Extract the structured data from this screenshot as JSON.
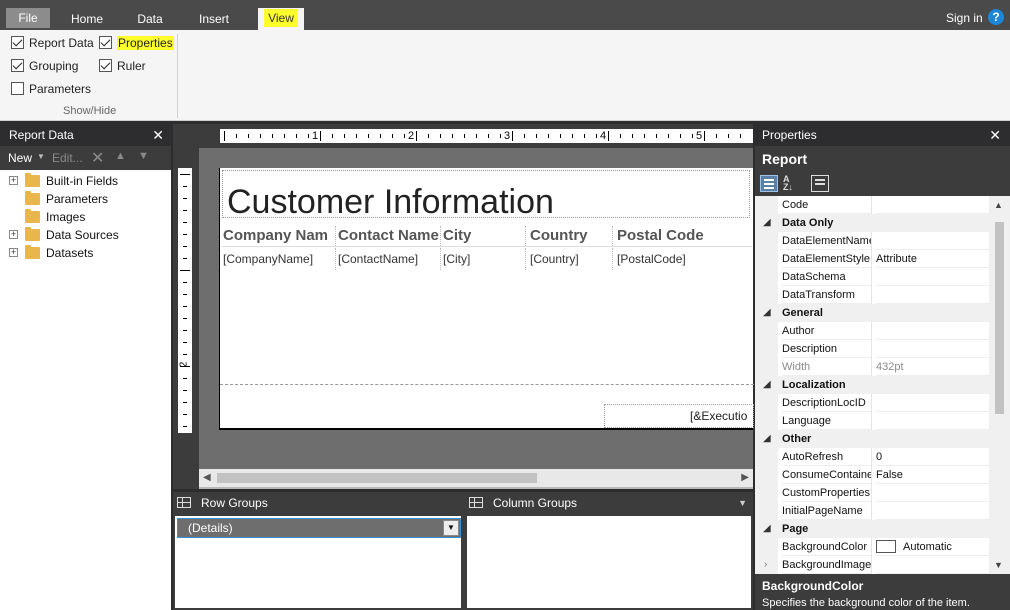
{
  "ribbon": {
    "tabs": [
      "File",
      "Home",
      "Data",
      "Insert",
      "View"
    ],
    "active_tab": "View",
    "sign_in": "Sign in",
    "help": "?",
    "checkboxes": {
      "report_data": {
        "label": "Report Data",
        "checked": true
      },
      "grouping": {
        "label": "Grouping",
        "checked": true
      },
      "parameters": {
        "label": "Parameters",
        "checked": false
      },
      "properties": {
        "label": "Properties",
        "checked": true
      },
      "ruler": {
        "label": "Ruler",
        "checked": true
      }
    },
    "group_label": "Show/Hide"
  },
  "report_data_panel": {
    "title": "Report Data",
    "close": "✕",
    "toolbar": {
      "new": "New",
      "edit": "Edit..."
    },
    "tree": [
      {
        "label": "Built-in Fields",
        "expandable": true
      },
      {
        "label": "Parameters",
        "expandable": false
      },
      {
        "label": "Images",
        "expandable": false
      },
      {
        "label": "Data Sources",
        "expandable": true
      },
      {
        "label": "Datasets",
        "expandable": true
      }
    ]
  },
  "design": {
    "ruler_numbers": [
      "1",
      "2",
      "3",
      "4",
      "5"
    ],
    "vertical_ruler_number": "2",
    "report_title": "Customer Information",
    "table": {
      "headers": [
        "Company Nam",
        "Contact Name",
        "City",
        "Country",
        "Postal Code"
      ],
      "fields": [
        "[CompanyName]",
        "[ContactName]",
        "[City]",
        "[Country]",
        "[PostalCode]"
      ]
    },
    "footer_expression": "[&Executio"
  },
  "grouping": {
    "row_groups_title": "Row Groups",
    "column_groups_title": "Column Groups",
    "row_group_item": "(Details)"
  },
  "properties_panel": {
    "title": "Properties",
    "close": "✕",
    "object": "Report",
    "rows": [
      {
        "kind": "prop",
        "name": "Code",
        "value": ""
      },
      {
        "kind": "cat",
        "name": "Data Only"
      },
      {
        "kind": "prop",
        "name": "DataElementName",
        "value": ""
      },
      {
        "kind": "prop",
        "name": "DataElementStyle",
        "value": "Attribute"
      },
      {
        "kind": "prop",
        "name": "DataSchema",
        "value": ""
      },
      {
        "kind": "prop",
        "name": "DataTransform",
        "value": ""
      },
      {
        "kind": "cat",
        "name": "General"
      },
      {
        "kind": "prop",
        "name": "Author",
        "value": ""
      },
      {
        "kind": "prop",
        "name": "Description",
        "value": ""
      },
      {
        "kind": "prop",
        "name": "Width",
        "value": "432pt",
        "disabled": true
      },
      {
        "kind": "cat",
        "name": "Localization"
      },
      {
        "kind": "prop",
        "name": "DescriptionLocID",
        "value": ""
      },
      {
        "kind": "prop",
        "name": "Language",
        "value": ""
      },
      {
        "kind": "cat",
        "name": "Other"
      },
      {
        "kind": "prop",
        "name": "AutoRefresh",
        "value": "0"
      },
      {
        "kind": "prop",
        "name": "ConsumeContainerWhitespace",
        "value": "False"
      },
      {
        "kind": "prop",
        "name": "CustomProperties",
        "value": ""
      },
      {
        "kind": "prop",
        "name": "InitialPageName",
        "value": ""
      },
      {
        "kind": "cat",
        "name": "Page"
      },
      {
        "kind": "prop",
        "name": "BackgroundColor",
        "value": "Automatic",
        "swatch": "#ffffff"
      },
      {
        "kind": "prop",
        "name": "BackgroundImage",
        "value": "",
        "expandable": true
      }
    ],
    "description": {
      "title": "BackgroundColor",
      "text": "Specifies the background color of the item."
    }
  },
  "colors": {
    "highlight": "#ffff2b",
    "dark_chrome": "#2d2d30",
    "folder": "#e8b64c",
    "selection_border": "#3c8fd6"
  }
}
